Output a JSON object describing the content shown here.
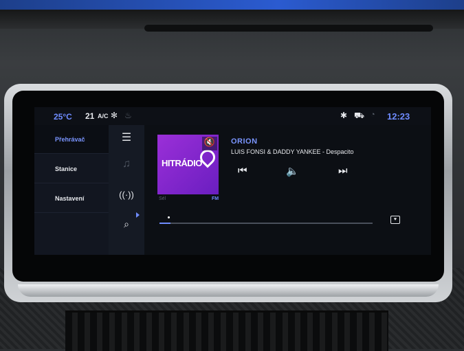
{
  "status_bar": {
    "temperature": "25°C",
    "fan_level": "21",
    "ac_label": "A/C",
    "time": "12:23",
    "icons": [
      "fan-icon",
      "seat-heat-icon",
      "bluetooth-icon",
      "car-connect-icon",
      "signal-icon"
    ]
  },
  "menu": {
    "items": [
      {
        "label": "Přehrávač",
        "active": true
      },
      {
        "label": "Stanice",
        "active": false
      },
      {
        "label": "Nastavení",
        "active": false
      }
    ]
  },
  "side_icons": [
    "menu-icon",
    "music-note-icon",
    "radio-signal-icon",
    "search-icon"
  ],
  "player": {
    "art_label": "HITRÁDIO",
    "band": "Sél",
    "band_type": "FM",
    "station": "ORION",
    "track": "LUIS FONSI & DADDY YANKEE - Despacito",
    "progress": 0.05,
    "controls": [
      "previous-icon",
      "volume-icon",
      "next-icon"
    ]
  },
  "colors": {
    "accent": "#6f8cff",
    "art_bg": "#8a2be2"
  }
}
